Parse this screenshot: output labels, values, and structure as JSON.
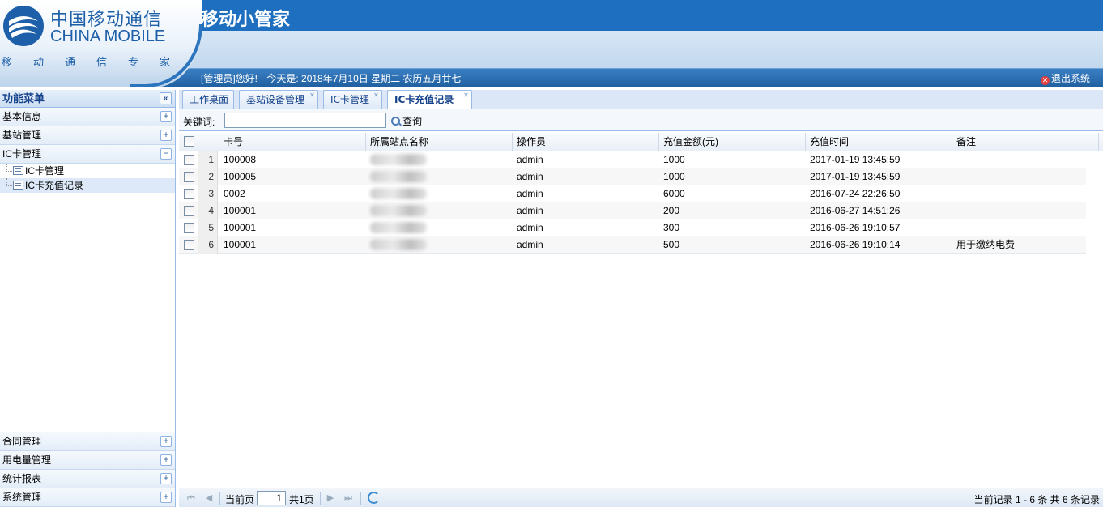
{
  "header": {
    "logo_cn": "中国移动通信",
    "logo_en": "CHINA MOBILE",
    "logo_slogan": "移动通信专家",
    "app_title": "移动小管家",
    "welcome_user": "[管理员]您好!",
    "welcome_date": "今天是: 2018年7月10日 星期二 农历五月廿七",
    "logout_label": "退出系统"
  },
  "sidebar": {
    "title": "功能菜单",
    "collapse_symbol": "«",
    "top_groups": [
      {
        "label": "基本信息",
        "toggle": "+"
      },
      {
        "label": "基站管理",
        "toggle": "+"
      },
      {
        "label": "IC卡管理",
        "toggle": "−"
      }
    ],
    "sub_items": [
      {
        "label": "IC卡管理"
      },
      {
        "label": "IC卡充值记录"
      }
    ],
    "bottom_groups": [
      {
        "label": "合同管理",
        "toggle": "+"
      },
      {
        "label": "用电量管理",
        "toggle": "+"
      },
      {
        "label": "统计报表",
        "toggle": "+"
      },
      {
        "label": "系统管理",
        "toggle": "+"
      }
    ]
  },
  "tabs": [
    {
      "label": "工作桌面"
    },
    {
      "label": "基站设备管理"
    },
    {
      "label": "IC卡管理"
    },
    {
      "label": "IC卡充值记录"
    }
  ],
  "search": {
    "label": "关键词:",
    "value": "",
    "button_label": "查询"
  },
  "grid": {
    "columns": [
      "卡号",
      "所属站点名称",
      "操作员",
      "充值金额(元)",
      "充值时间",
      "备注"
    ],
    "rows": [
      {
        "num": "1",
        "card": "100008",
        "site": "",
        "operator": "admin",
        "amount": "1000",
        "time": "2017-01-19 13:45:59",
        "note": ""
      },
      {
        "num": "2",
        "card": "100005",
        "site": "",
        "operator": "admin",
        "amount": "1000",
        "time": "2017-01-19 13:45:59",
        "note": ""
      },
      {
        "num": "3",
        "card": "0002",
        "site": "",
        "operator": "admin",
        "amount": "6000",
        "time": "2016-07-24 22:26:50",
        "note": ""
      },
      {
        "num": "4",
        "card": "100001",
        "site": "",
        "operator": "admin",
        "amount": "200",
        "time": "2016-06-27 14:51:26",
        "note": ""
      },
      {
        "num": "5",
        "card": "100001",
        "site": "",
        "operator": "admin",
        "amount": "300",
        "time": "2016-06-26 19:10:57",
        "note": ""
      },
      {
        "num": "6",
        "card": "100001",
        "site": "",
        "operator": "admin",
        "amount": "500",
        "time": "2016-06-26 19:10:14",
        "note": "用于缴纳电费"
      }
    ]
  },
  "pager": {
    "current_label": "当前页",
    "page_value": "1",
    "total_label": "共1页",
    "info": "当前记录 1 - 6 条 共 6 条记录"
  }
}
